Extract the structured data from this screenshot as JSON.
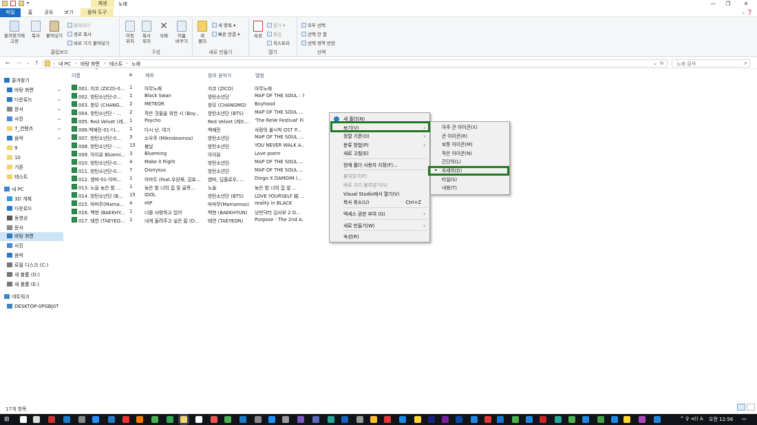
{
  "window": {
    "context_tab_label": "재생",
    "title": "노래"
  },
  "tabs": [
    "파일",
    "홈",
    "공유",
    "보기",
    "음악 도구"
  ],
  "ribbon": {
    "clipboard": {
      "pin": "즐겨찾기에\n고정",
      "copy": "복사",
      "paste": "붙여넣기",
      "cut": "잘라내기",
      "copy_path": "경로 복사",
      "paste_shortcut": "바로 가기 붙여넣기",
      "label": "클립보드"
    },
    "organize": {
      "move": "이동\n위치",
      "copy_to": "복사\n위치",
      "delete": "삭제",
      "rename": "이름\n바꾸기",
      "label": "구성"
    },
    "new": {
      "new_folder": "새\n폴더",
      "new_item": "새 항목",
      "easy_access": "빠른 연결",
      "label": "새로 만들기"
    },
    "open": {
      "properties": "속성",
      "open": "열기",
      "edit": "편집",
      "history": "히스토리",
      "label": "열기"
    },
    "select": {
      "select_all": "모두 선택",
      "select_none": "선택 안 함",
      "invert": "선택 영역 반전",
      "label": "선택"
    }
  },
  "address": {
    "crumbs": [
      "내 PC",
      "바탕 화면",
      "테스트",
      "노래"
    ],
    "search_placeholder": "노래 검색"
  },
  "nav": {
    "items": [
      {
        "label": "즐겨찾기",
        "pinned": false,
        "selected": false
      },
      {
        "label": "바탕 화면",
        "pinned": true,
        "selected": false
      },
      {
        "label": "다운로드",
        "pinned": true,
        "selected": false
      },
      {
        "label": "문서",
        "pinned": true,
        "selected": false
      },
      {
        "label": "사진",
        "pinned": true,
        "selected": false
      },
      {
        "label": "7_컨텐츠",
        "pinned": true,
        "selected": false
      },
      {
        "label": "음악",
        "pinned": true,
        "selected": false
      },
      {
        "label": "9",
        "pinned": false,
        "selected": false
      },
      {
        "label": "10",
        "pinned": false,
        "selected": false
      },
      {
        "label": "기존",
        "pinned": false,
        "selected": false
      },
      {
        "label": "테스트",
        "pinned": false,
        "selected": false
      },
      {
        "label": "내 PC",
        "pinned": false,
        "selected": false
      },
      {
        "label": "3D 개체",
        "pinned": false,
        "selected": false
      },
      {
        "label": "다운로드",
        "pinned": false,
        "selected": false
      },
      {
        "label": "동영상",
        "pinned": false,
        "selected": false
      },
      {
        "label": "문서",
        "pinned": false,
        "selected": false
      },
      {
        "label": "바탕 화면",
        "pinned": false,
        "selected": true
      },
      {
        "label": "사진",
        "pinned": false,
        "selected": false
      },
      {
        "label": "음악",
        "pinned": false,
        "selected": false
      },
      {
        "label": "로컬 디스크 (C:)",
        "pinned": false,
        "selected": false
      },
      {
        "label": "새 볼륨 (D:)",
        "pinned": false,
        "selected": false
      },
      {
        "label": "새 볼륨 (E:)",
        "pinned": false,
        "selected": false
      },
      {
        "label": "네트워크",
        "pinned": false,
        "selected": false
      },
      {
        "label": "DESKTOP-0PGBJ0T",
        "pinned": false,
        "selected": false
      }
    ]
  },
  "columns": [
    "이름",
    "#",
    "제목",
    "참여 음악가",
    "앨범"
  ],
  "files": [
    [
      "001. 지코 (ZICO)-0...",
      "1",
      "아무노래",
      "지코 (ZICO)",
      "아무노래"
    ],
    [
      "002. 방탄소년단-0...",
      "1",
      "Black Swan",
      "방탄소년단",
      "MAP OF THE SOUL : 7"
    ],
    [
      "003. 창모 (CHANG...",
      "2",
      "METEOR",
      "창모 (CHANGMO)",
      "Boyhood"
    ],
    [
      "004. 방탄소년단 - ...",
      "2",
      "작은 것들을 위한 시 (Boy...",
      "방탄소년단 (BTS)",
      "MAP OF THE SOUL ..."
    ],
    [
      "005. Red Velvet (레...",
      "1",
      "Psycho",
      "Red Velvet (레드...",
      "'The ReVe Festival' Fi..."
    ],
    [
      "006.백예린-01-다...",
      "1",
      "다시 난, 여기",
      "백예린",
      "사랑의 불시착 OST P..."
    ],
    [
      "007. 방탄소년단-0...",
      "3",
      "소우주 (Mikrokosmos)",
      "방탄소년단",
      "MAP OF THE SOUL ..."
    ],
    [
      "008. 방탄소년단 - ...",
      "15",
      "봄날",
      "방탄소년단",
      "YOU NEVER WALK A..."
    ],
    [
      "009. 아이유 Bluemi...",
      "3",
      "Blueming",
      "아이유",
      "Love poem"
    ],
    [
      "010. 방탄소년단-0...",
      "4",
      "Make it Right",
      "방탄소년단",
      "MAP OF THE SOUL ..."
    ],
    [
      "011. 방탄소년단-0...",
      "7",
      "Dionysus",
      "방탄소년단",
      "MAP OF THE SOUL ..."
    ],
    [
      "012. 염따-01-아마...",
      "1",
      "아마두 (feat.우원재, 김효...",
      "염따, 딥플로우, ...",
      "Dingo X DAMOIM (..."
    ],
    [
      "013. 노을 늦은 밤 ...",
      "1",
      "늦은 밤 너의 집 앞 골목...",
      "노을",
      "늦은 밤 너의 집 앞 ..."
    ],
    [
      "014. 방탄소년단 (B...",
      "15",
      "IDOL",
      "방탄소년단 (BTS)",
      "LOVE YOURSELF 結 ..."
    ],
    [
      "015. 마마무(Mama...",
      "4",
      "HIP",
      "마마무(Mamamoo)",
      "reality in BLACK"
    ],
    [
      "016. 백현 (BAEKHY...",
      "1",
      "너를 사랑하고 있어",
      "백현 (BAEKHYUN)",
      "낭만닥터 김사부 2 O..."
    ],
    [
      "017. 태연 (TAEYEO...",
      "1",
      "내게 들려주고 싶은 말 (D...",
      "태연 (TAEYEON)",
      "Purpose - The 2nd A..."
    ]
  ],
  "context_menu": {
    "items": [
      {
        "label": "새 폴더(N)",
        "type": "item",
        "disabled": false,
        "submenu": false,
        "shortcut": ""
      },
      {
        "label": "보기(V)",
        "type": "item",
        "disabled": false,
        "submenu": true,
        "shortcut": ""
      },
      {
        "label": "정렬 기준(O)",
        "type": "item",
        "disabled": false,
        "submenu": true,
        "shortcut": ""
      },
      {
        "label": "분류 방법(P)",
        "type": "item",
        "disabled": false,
        "submenu": true,
        "shortcut": ""
      },
      {
        "label": "새로 고침(E)",
        "type": "item",
        "disabled": false,
        "submenu": false,
        "shortcut": ""
      },
      {
        "label": "현재 폴더 사용자 지정(F)...",
        "type": "item",
        "disabled": false,
        "submenu": false,
        "shortcut": ""
      },
      {
        "label": "붙여넣기(P)",
        "type": "item",
        "disabled": true,
        "submenu": false,
        "shortcut": ""
      },
      {
        "label": "바로 가기 붙여넣기(S)",
        "type": "item",
        "disabled": true,
        "submenu": false,
        "shortcut": ""
      },
      {
        "label": "Visual Studio에서 열기(V)",
        "type": "item",
        "disabled": false,
        "submenu": false,
        "shortcut": ""
      },
      {
        "label": "복사 취소(U)",
        "type": "item",
        "disabled": false,
        "submenu": false,
        "shortcut": "Ctrl+Z"
      },
      {
        "label": "액세스 권한 부여 (G)",
        "type": "item",
        "disabled": false,
        "submenu": true,
        "shortcut": ""
      },
      {
        "label": "새로 만들기(W)",
        "type": "item",
        "disabled": false,
        "submenu": true,
        "shortcut": ""
      },
      {
        "label": "속성(R)",
        "type": "item",
        "disabled": false,
        "submenu": false,
        "shortcut": ""
      }
    ],
    "view_submenu": [
      {
        "label": "아주 큰 아이콘(X)",
        "checked": false
      },
      {
        "label": "큰 아이콘(R)",
        "checked": false
      },
      {
        "label": "보통 아이콘(M)",
        "checked": false
      },
      {
        "label": "작은 아이콘(N)",
        "checked": false
      },
      {
        "label": "간단히(L)",
        "checked": false
      },
      {
        "label": "자세히(D)",
        "checked": true
      },
      {
        "label": "타일(S)",
        "checked": false
      },
      {
        "label": "내용(T)",
        "checked": false
      }
    ]
  },
  "status": {
    "count": "17개 항목"
  },
  "taskbar": {
    "tray_text": "^ ♀ ⊲)) A",
    "time": "오전 12:56"
  }
}
